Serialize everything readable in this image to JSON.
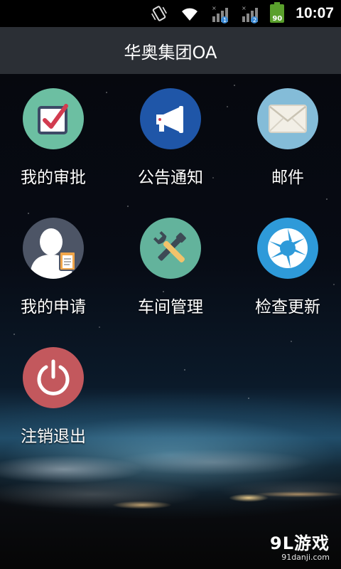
{
  "status_bar": {
    "icons": [
      "vibrate-icon",
      "wifi-icon",
      "signal-1-icon",
      "signal-2-icon",
      "battery-icon"
    ],
    "sim1_badge": "1",
    "sim2_badge": "2",
    "battery_level": "90",
    "time": "10:07"
  },
  "header": {
    "title": "华奥集团OA"
  },
  "menu": {
    "items": [
      {
        "label": "我的审批",
        "icon": "approval-checkbox-icon",
        "color": "#6cbfa2"
      },
      {
        "label": "公告通知",
        "icon": "megaphone-icon",
        "color": "#1f56a8"
      },
      {
        "label": "邮件",
        "icon": "envelope-icon",
        "color": "#84bcd8"
      },
      {
        "label": "我的申请",
        "icon": "user-clipboard-icon",
        "color": "#4d5566"
      },
      {
        "label": "车间管理",
        "icon": "tools-icon",
        "color": "#63b39c"
      },
      {
        "label": "检查更新",
        "icon": "aperture-icon",
        "color": "#2e9ad9"
      },
      {
        "label": "注销退出",
        "icon": "power-icon",
        "color": "#c3585d"
      }
    ]
  },
  "watermark": {
    "main": "9L游戏",
    "sub": "91danji.com"
  }
}
